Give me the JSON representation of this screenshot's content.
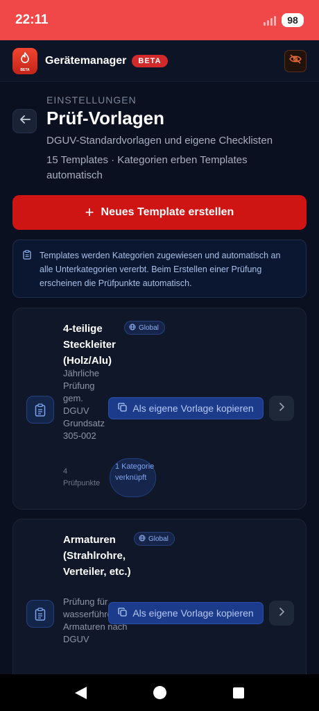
{
  "status": {
    "time": "22:11",
    "battery": "98"
  },
  "app": {
    "name": "Gerätemanager",
    "beta": "BETA",
    "logo_badge": "BETA"
  },
  "header": {
    "eyebrow": "EINSTELLUNGEN",
    "title": "Prüf-Vorlagen",
    "subtitle": "DGUV-Standardvorlagen und eigene Checklisten",
    "count": "15 Templates · Kategorien erben Templates automatisch"
  },
  "new_button": {
    "label": "Neues Template erstellen"
  },
  "info": {
    "text": "Templates werden Kategorien zugewiesen und automatisch an alle Unterkategorien vererbt. Beim Erstellen einer Prüfung erscheinen die Prüfpunkte automatisch."
  },
  "templates": [
    {
      "name": "4-teilige Steckleiter (Holz/Alu)",
      "scope": "Global",
      "description": "Jährliche Prüfung gem. DGUV Grundsatz 305-002",
      "copy_label": "Als eigene Vorlage kopieren",
      "points": "4 Prüfpunkte",
      "categories": "1 Kategorie verknüpft"
    },
    {
      "name": "Armaturen (Strahlrohre, Verteiler, etc.)",
      "scope": "Global",
      "description": "Prüfung für wasserführende Armaturen nach DGUV",
      "copy_label": "Als eigene Vorlage kopieren"
    }
  ],
  "icons": {
    "app_logo": "flame-icon",
    "visibility": "eye-off-icon",
    "back": "arrow-left-icon",
    "new": "plus-icon",
    "info": "clipboard-icon",
    "template": "clipboard-list-icon",
    "scope": "globe-icon",
    "copy": "copy-icon",
    "open": "chevron-right-icon"
  },
  "colors": {
    "status_bar": "#f04848",
    "primary": "#cf1414",
    "accent": "#1c3b8a",
    "background": "#0a1020"
  }
}
